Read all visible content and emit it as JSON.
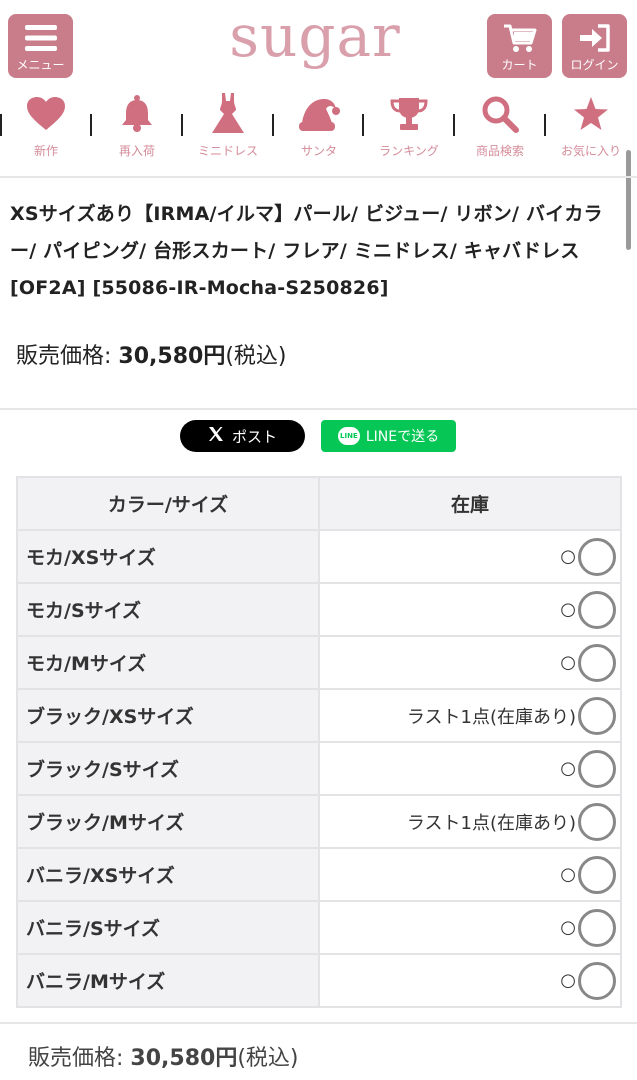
{
  "header": {
    "logo": "sugar",
    "menu_label": "メニュー",
    "cart_label": "カート",
    "login_label": "ログイン"
  },
  "nav": [
    {
      "label": "新作",
      "icon": "heart-icon"
    },
    {
      "label": "再入荷",
      "icon": "bell-icon"
    },
    {
      "label": "ミニドレス",
      "icon": "dress-icon"
    },
    {
      "label": "サンタ",
      "icon": "santa-hat-icon"
    },
    {
      "label": "ランキング",
      "icon": "trophy-icon"
    },
    {
      "label": "商品検索",
      "icon": "search-icon"
    },
    {
      "label": "お気に入り",
      "icon": "star-icon"
    }
  ],
  "product": {
    "title": "XSサイズあり【IRMA/イルマ】パール/ ビジュー/ リボン/ バイカラー/ パイピング/ 台形スカート/ フレア/ ミニドレス/ キャバドレス[OF2A] [55086-IR-Mocha-S250826]",
    "price_label": "販売価格:",
    "price_value": "30,580円",
    "tax_note": "(税込)"
  },
  "share": {
    "x_label": "ポスト",
    "line_badge": "LINE",
    "line_label": "LINEで送る"
  },
  "stock_table": {
    "headers": [
      "カラー/サイズ",
      "在庫"
    ],
    "rows": [
      {
        "option": "モカ/XSサイズ",
        "stock": "○"
      },
      {
        "option": "モカ/Sサイズ",
        "stock": "○"
      },
      {
        "option": "モカ/Mサイズ",
        "stock": "○"
      },
      {
        "option": "ブラック/XSサイズ",
        "stock": "ラスト1点(在庫あり)"
      },
      {
        "option": "ブラック/Sサイズ",
        "stock": "○"
      },
      {
        "option": "ブラック/Mサイズ",
        "stock": "ラスト1点(在庫あり)"
      },
      {
        "option": "バニラ/XSサイズ",
        "stock": "○"
      },
      {
        "option": "バニラ/Sサイズ",
        "stock": "○"
      },
      {
        "option": "バニラ/Mサイズ",
        "stock": "○"
      }
    ]
  },
  "footer_price": {
    "label": "販売価格:",
    "value": "30,580円",
    "tax_note": "(税込)"
  },
  "colors": {
    "brand_pink": "#c97d8b",
    "logo_pink": "#d9a0ac",
    "line_green": "#06c755"
  }
}
